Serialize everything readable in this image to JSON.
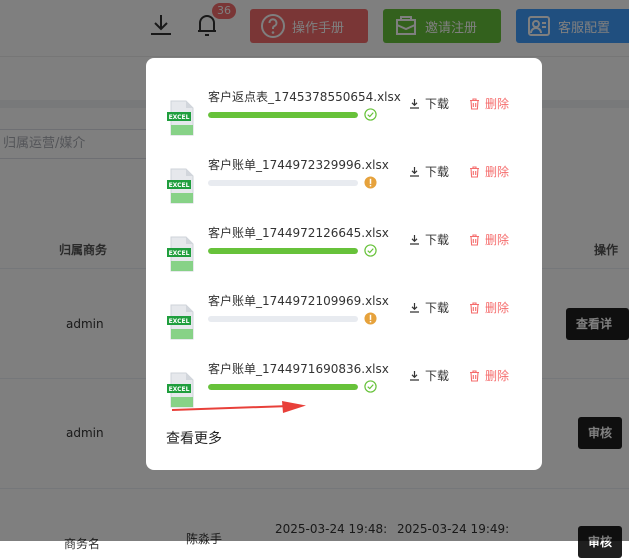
{
  "header": {
    "badge_count": "36",
    "buttons": {
      "manual": "操作手册",
      "invite": "邀请注册",
      "service": "客服配置"
    }
  },
  "filter": {
    "placeholder": "归属运营/媒介"
  },
  "table": {
    "columns": {
      "owner": "归属商务",
      "ops": "操作"
    },
    "rows": [
      {
        "owner": "admin",
        "action": "查看详情"
      },
      {
        "owner": "admin",
        "action": "审核"
      },
      {
        "owner": "商务名",
        "media": "陈淼手",
        "time1": "2025-03-24 19:48:",
        "time2": "2025-03-24 19:49:",
        "action": "审核"
      }
    ]
  },
  "popup": {
    "files": [
      {
        "name": "客户返点表_1745378550654.xlsx",
        "progress": 1.0,
        "status": "success"
      },
      {
        "name": "客户账单_1744972329996.xlsx",
        "progress": 0.0,
        "status": "warning"
      },
      {
        "name": "客户账单_1744972126645.xlsx",
        "progress": 1.0,
        "status": "success"
      },
      {
        "name": "客户账单_1744972109969.xlsx",
        "progress": 0.0,
        "status": "warning"
      },
      {
        "name": "客户账单_1744971690836.xlsx",
        "progress": 1.0,
        "status": "success"
      }
    ],
    "download_label": "下载",
    "delete_label": "删除",
    "view_more": "查看更多",
    "icon_label": "EXCEL"
  },
  "colors": {
    "success": "#67c23a",
    "warning": "#e6a23c",
    "danger": "#f56c6c",
    "primary": "#409eff"
  }
}
